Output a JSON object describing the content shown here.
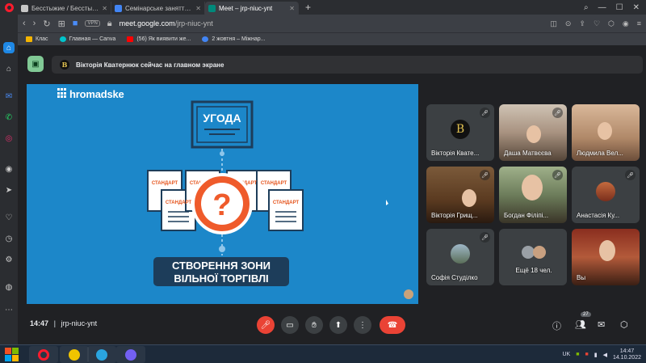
{
  "browser": {
    "tabs": [
      {
        "label": "Бесстыжие / Бесстыдник",
        "color": "#c7c7c7",
        "active": false
      },
      {
        "label": "Семінарське заняття №2 Т",
        "color": "#4285f4",
        "active": false
      },
      {
        "label": "Meet – jrp-niuc-ynt",
        "color": "#00897b",
        "active": true
      }
    ],
    "new_tab": "+",
    "vpn_label": "VPN",
    "url_host": "meet.google.com",
    "url_path": "/jrp-niuc-ynt",
    "bookmarks": [
      {
        "label": "Клас",
        "color": "#f4b400"
      },
      {
        "label": "Главная — Canva",
        "color": "#00c4cc"
      },
      {
        "label": "(56) Як виявити же...",
        "color": "#ff0000"
      },
      {
        "label": "2 жовтня – Міжнар...",
        "color": "#4285f4"
      }
    ]
  },
  "meet": {
    "banner_text": "Вікторія Кватернюк сейчас на главном экране",
    "banner_avatar_letter": "B",
    "screen": {
      "brand": "hromadske",
      "doc_title": "УГОДА",
      "doc_label": "СТАНДАРТ",
      "question_mark": "?",
      "caption_line1": "СТВОРЕННЯ ЗОНИ",
      "caption_line2": "ВІЛЬНОЇ ТОРГІВЛІ"
    },
    "participants": [
      {
        "name": "Вікторія Кватернюк",
        "display": "Вікторія Квате...",
        "muted": true
      },
      {
        "name": "Даша Матвєєва",
        "display": "Даша Матвєєва",
        "muted": true
      },
      {
        "name": "Людмила Вел...",
        "display": "Людмила Вел...",
        "muted": false
      },
      {
        "name": "Вікторія Грищ...",
        "display": "Вікторія Грищ...",
        "muted": true
      },
      {
        "name": "Богдан Філіпі...",
        "display": "Богдан Філіпі...",
        "muted": true
      },
      {
        "name": "Анастасія Ку...",
        "display": "Анастасія Ку...",
        "muted": true
      },
      {
        "name": "Софія Студілко",
        "display": "Софія Студілко",
        "muted": true
      },
      {
        "name": "Ещё 18 чел.",
        "display": "Ещё 18 чел.",
        "muted": false
      },
      {
        "name": "Вы",
        "display": "Вы",
        "muted": false
      }
    ],
    "time": "14:47",
    "meeting_code": "jrp-niuc-ynt",
    "people_count": "27"
  },
  "taskbar": {
    "lang": "UK",
    "clock_time": "14:47",
    "clock_date": "14.10.2022"
  },
  "colors": {
    "meet_bg": "#202124",
    "screen_blue": "#1c87c9",
    "hangup_red": "#ea4335",
    "present_green": "#81c995",
    "question_orange": "#ef5b2b"
  }
}
